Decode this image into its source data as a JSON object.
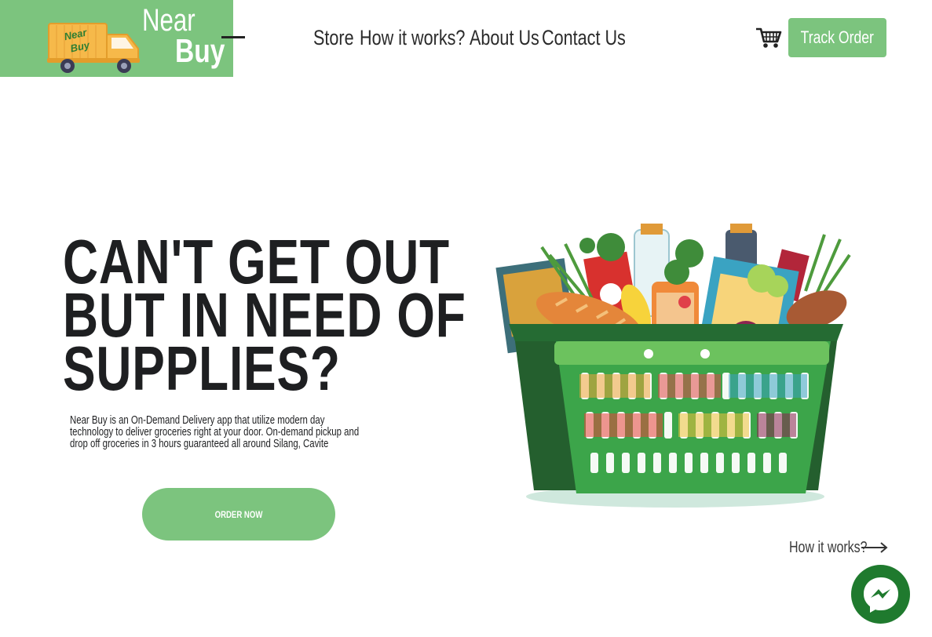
{
  "brand": {
    "name_top": "Near",
    "name_bottom": "Buy",
    "truck_text_1": "Near",
    "truck_text_2": "Buy",
    "accent_color": "#7cc47e"
  },
  "nav": {
    "items": [
      {
        "label": "Store"
      },
      {
        "label": "How it works?"
      },
      {
        "label": "About Us"
      },
      {
        "label": "Contact Us"
      }
    ],
    "cart_icon": "shopping-cart-icon",
    "track_label": "Track Order"
  },
  "hero": {
    "headline_lines": [
      "CAN'T GET OUT",
      "BUT IN NEED OF",
      "SUPPLIES?"
    ],
    "description_lines": [
      "Near Buy is an On-Demand Delivery app that utilize modern day",
      "technology to deliver groceries right at your door. On-demand pickup and",
      "drop off groceries in 3 hours guaranteed all around Silang, Cavite"
    ],
    "cta_label": "ORDER NOW",
    "image_icon": "grocery-basket-illustration"
  },
  "footer_link": {
    "label": "How it works?",
    "icon": "arrow-right-icon"
  },
  "chat": {
    "icon": "messenger-icon",
    "color": "#1f7a2e"
  }
}
